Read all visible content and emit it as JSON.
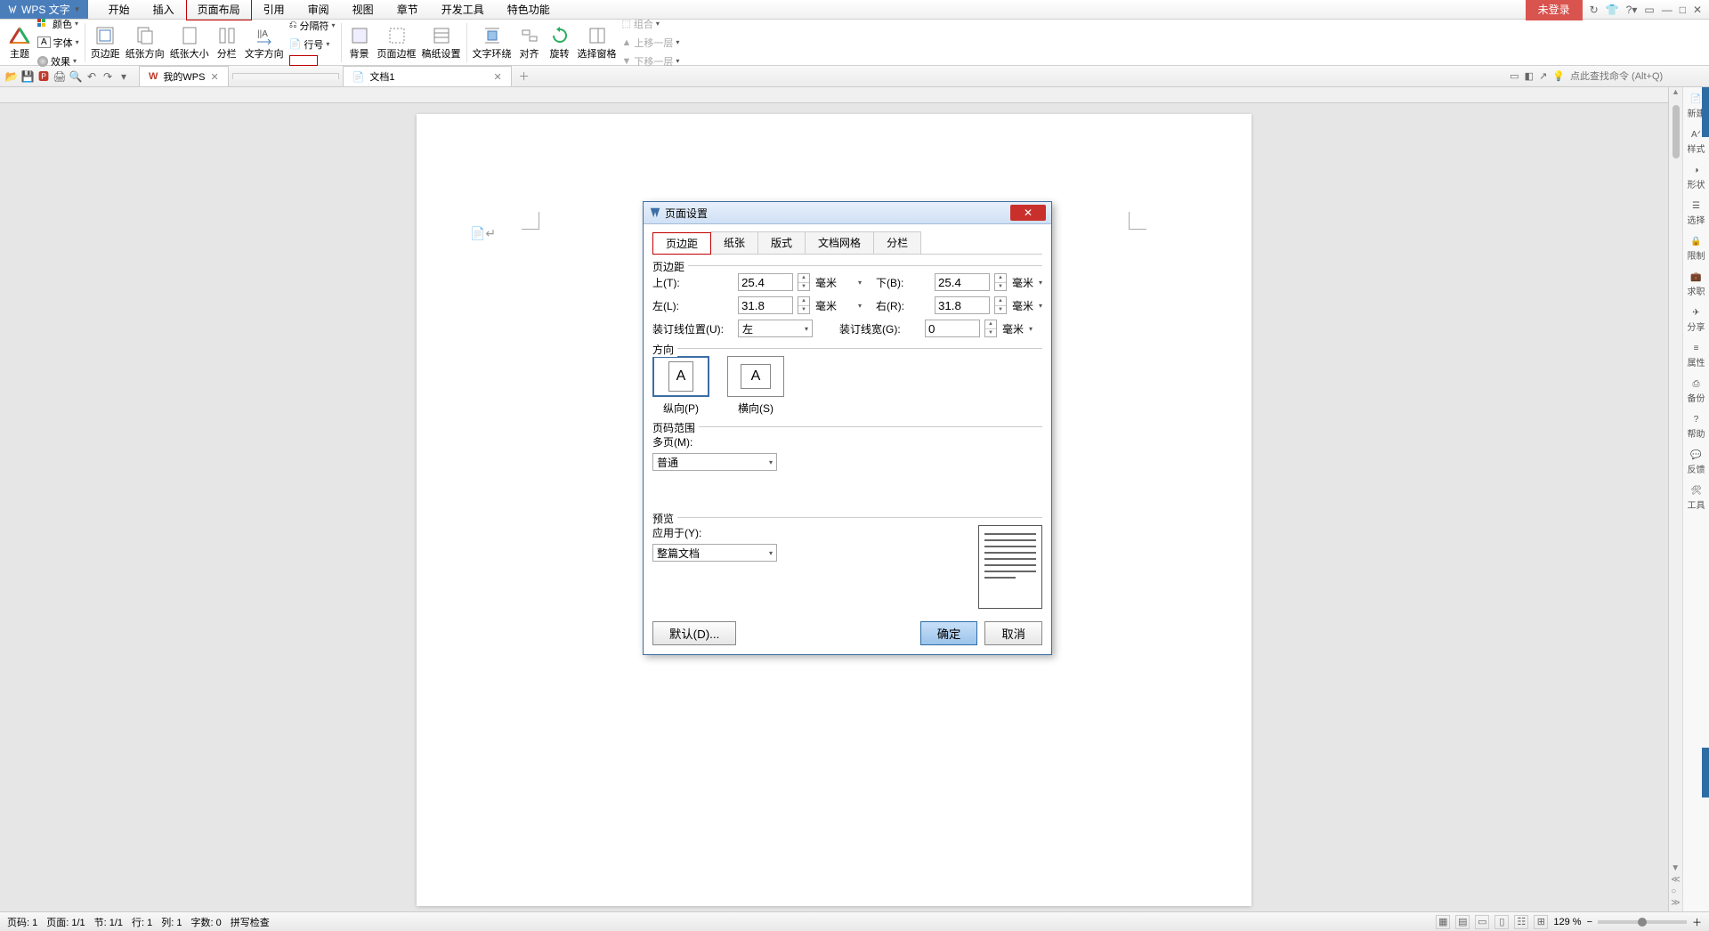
{
  "app": {
    "name": "WPS 文字"
  },
  "menu": [
    "开始",
    "插入",
    "页面布局",
    "引用",
    "审阅",
    "视图",
    "章节",
    "开发工具",
    "特色功能"
  ],
  "menu_highlight": 2,
  "title_right": {
    "login": "未登录"
  },
  "ribbon": {
    "theme": "主题",
    "font": "字体",
    "effect": "效果",
    "color": "颜色",
    "margins": "页边距",
    "direction": "纸张方向",
    "size": "纸张大小",
    "columns": "分栏",
    "textdir": "文字方向",
    "lineno": "行号",
    "breaks": "分隔符",
    "bg": "背景",
    "border": "页面边框",
    "manuscript": "稿纸设置",
    "wrap": "文字环绕",
    "align": "对齐",
    "rotate": "旋转",
    "pane": "选择窗格",
    "group": "组合",
    "forward": "上移一层",
    "backward": "下移一层"
  },
  "tabs": {
    "tab1": "我的WPS",
    "tab2": "文档1"
  },
  "search_placeholder": "点此查找命令 (Alt+Q)",
  "sidebar": [
    "新建",
    "样式",
    "形状",
    "选择",
    "限制",
    "求职",
    "分享",
    "属性",
    "备份",
    "帮助",
    "反馈",
    "工具"
  ],
  "status": {
    "page_lbl": "页码: 1",
    "pages": "页面: 1/1",
    "sec": "节: 1/1",
    "line": "行: 1",
    "col": "列: 1",
    "chars": "字数: 0",
    "spell": "拼写检查",
    "zoom": "129 %"
  },
  "dialog": {
    "title": "页面设置",
    "tabs": [
      "页边距",
      "纸张",
      "版式",
      "文档网格",
      "分栏"
    ],
    "active_tab": 0,
    "sec_margin": "页边距",
    "top": "上(T):",
    "bottom": "下(B):",
    "left": "左(L):",
    "right": "右(R):",
    "v_top": "25.4",
    "v_bottom": "25.4",
    "v_left": "31.8",
    "v_right": "31.8",
    "unit": "毫米",
    "gutter_pos": "装订线位置(U):",
    "gutter_val": "左",
    "gutter_w": "装订线宽(G):",
    "gutter_w_val": "0",
    "sec_orient": "方向",
    "portrait": "纵向(P)",
    "landscape": "横向(S)",
    "sec_range": "页码范围",
    "multi": "多页(M):",
    "multi_val": "普通",
    "sec_preview": "预览",
    "apply": "应用于(Y):",
    "apply_val": "整篇文档",
    "default": "默认(D)...",
    "ok": "确定",
    "cancel": "取消"
  }
}
